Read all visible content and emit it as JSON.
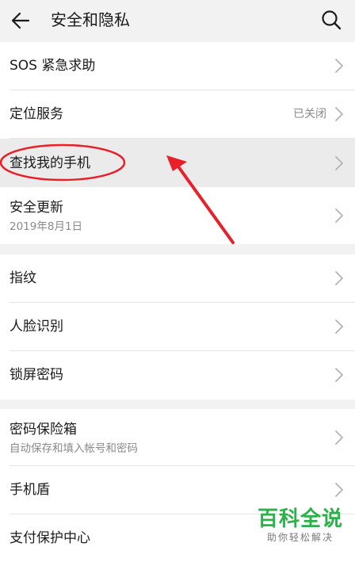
{
  "header": {
    "title": "安全和隐私",
    "back_icon": "arrow-left-icon",
    "search_icon": "search-icon"
  },
  "groups": [
    {
      "items": [
        {
          "label": "SOS 紧急求助"
        },
        {
          "label": "定位服务",
          "value": "已关闭"
        },
        {
          "label": "查找我的手机",
          "highlighted": true
        },
        {
          "label": "安全更新",
          "sub": "2019年8月1日"
        }
      ]
    },
    {
      "items": [
        {
          "label": "指纹"
        },
        {
          "label": "人脸识别"
        },
        {
          "label": "锁屏密码"
        }
      ]
    },
    {
      "items": [
        {
          "label": "密码保险箱",
          "sub": "自动保存和填入帐号和密码"
        },
        {
          "label": "手机盾"
        },
        {
          "label": "支付保护中心"
        }
      ]
    }
  ],
  "annotation": {
    "color": "#e8202a"
  },
  "watermark": {
    "brand": "百科全说",
    "slogan": "助你轻松解决",
    "color": "#2cb14a"
  }
}
